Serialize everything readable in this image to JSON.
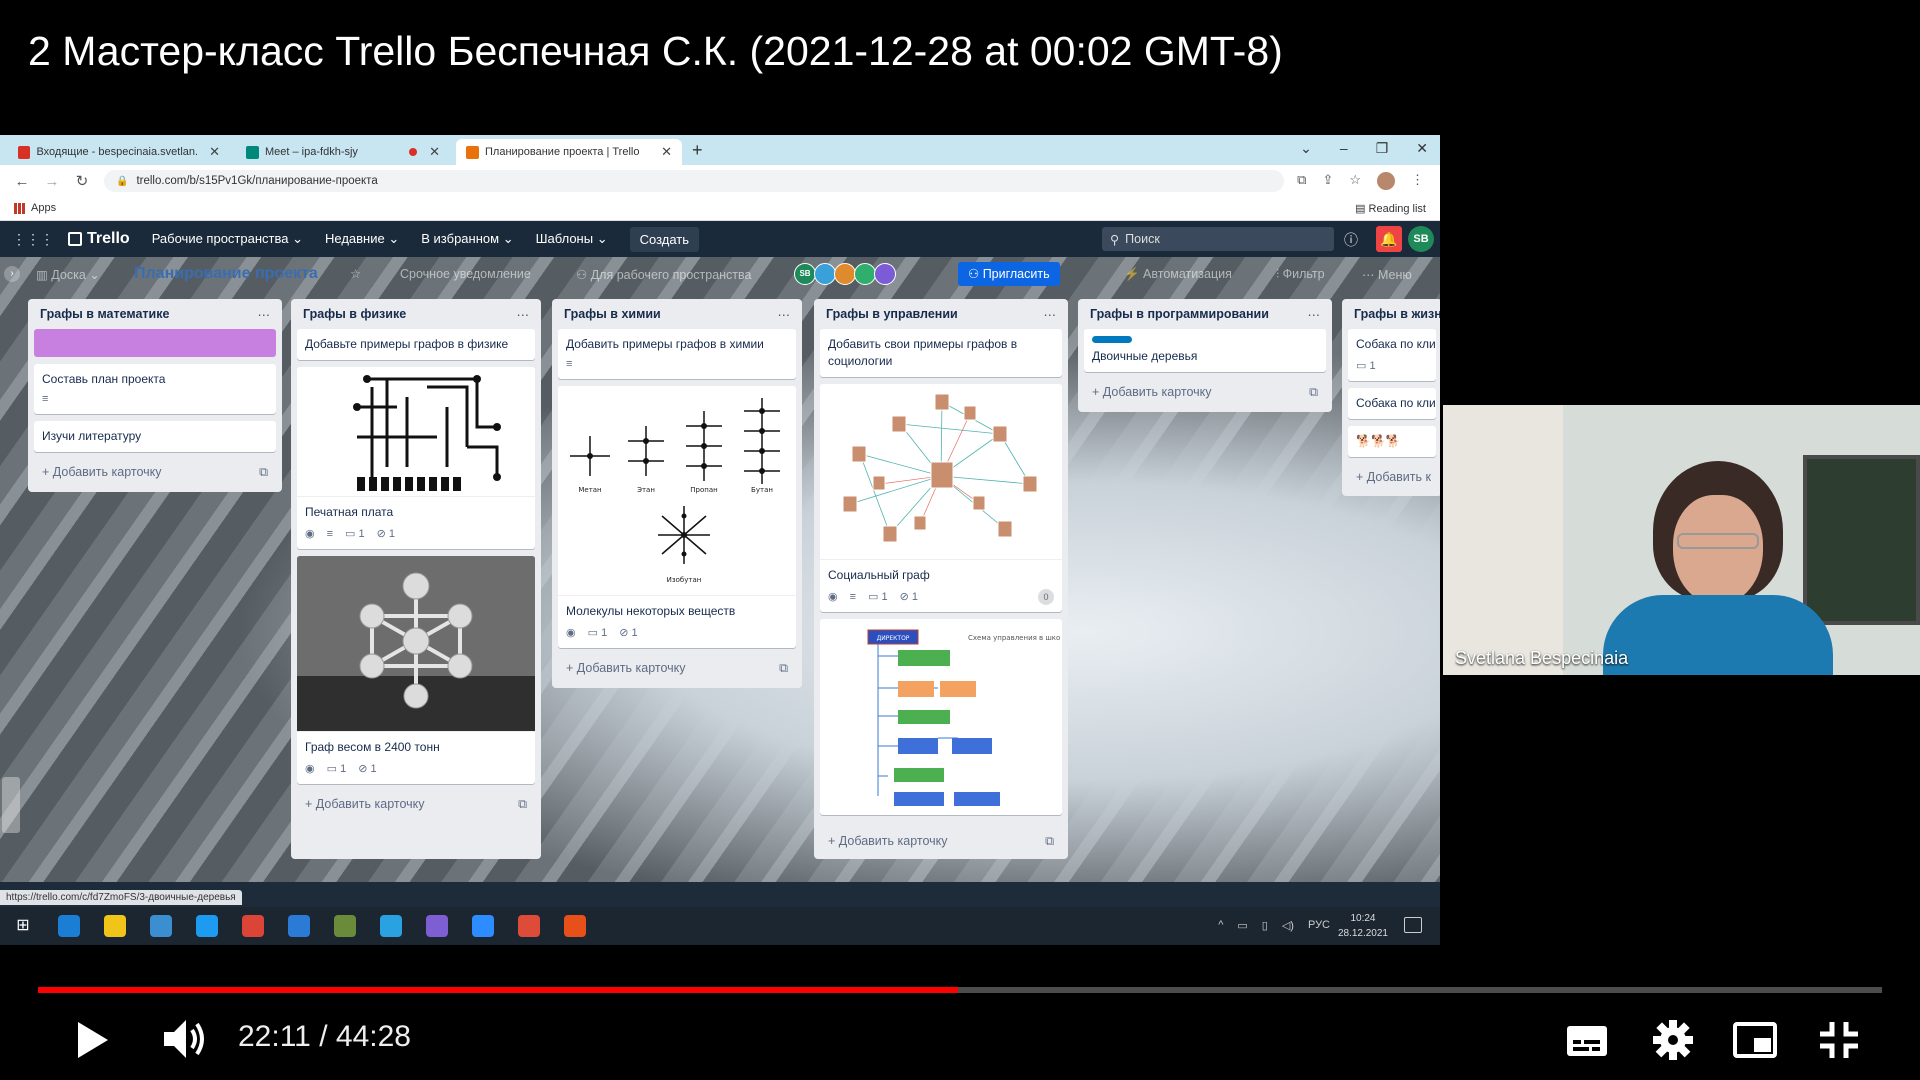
{
  "video": {
    "title": "2 Мастер-класс Trello Беспечная С.К. (2021-12-28 at 00:02 GMT-8)",
    "current_time": "22:11",
    "separator": "/",
    "duration": "44:28",
    "progress": 0.499
  },
  "browser": {
    "tabs": [
      {
        "label": "Входящие - bespecinaia.svetlan...",
        "icon_color": "#d93025"
      },
      {
        "label": "Meet – ipa-fdkh-sjy",
        "icon_color": "#00897b"
      },
      {
        "label": "Планирование проекта | Trello",
        "icon_color": "#e8710a"
      }
    ],
    "url": "trello.com/b/s15Pv1Gk/планирование-проекта",
    "bookmark_apps": "Apps",
    "reading_list": "Reading list",
    "status_url": "https://trello.com/c/fd7ZmoFS/3-двоичные-деревья"
  },
  "trello": {
    "logo": "Trello",
    "menu": [
      "Рабочие пространства",
      "Недавние",
      "В избранном",
      "Шаблоны"
    ],
    "create": "Создать",
    "search_placeholder": "Поиск",
    "avatar": "SB",
    "board": {
      "view": "Доска",
      "title": "Планирование проекта",
      "urgent": "Срочное уведомление",
      "workspace": "Для рабочего пространства",
      "members": [
        {
          "initials": "SB",
          "color": "#1e8a5a"
        },
        {
          "initials": "",
          "color": "#3aa0d8"
        },
        {
          "initials": "",
          "color": "#e08a2e"
        },
        {
          "initials": "",
          "color": "#2fae6e"
        },
        {
          "initials": "",
          "color": "#7b5cd6"
        }
      ],
      "invite": "Пригласить",
      "automation": "Автоматизация",
      "filter": "Фильтр",
      "menu": "Меню"
    },
    "add_card": "Добавить карточку",
    "add_card_short": "Добавить к",
    "lists": [
      {
        "title": "Графы в математике",
        "cards": [
          {
            "text": "Составь план проекта"
          },
          {
            "text": "Изучи литературу"
          }
        ]
      },
      {
        "title": "Графы в физике",
        "cards": [
          {
            "text": "Добавьте примеры графов в физике"
          },
          {
            "text": "Печатная плата",
            "comments": "1",
            "attachments": "1"
          },
          {
            "text": "Граф весом в 2400 тонн",
            "comments": "1",
            "attachments": "1"
          }
        ]
      },
      {
        "title": "Графы в химии",
        "cards": [
          {
            "text": "Добавить примеры графов в химии"
          },
          {
            "text": "Молекулы некоторых веществ",
            "comments": "1",
            "attachments": "1"
          }
        ],
        "molecules": [
          "Метан",
          "Этан",
          "Пропан",
          "Бутан",
          "Изобутан"
        ]
      },
      {
        "title": "Графы в управлении",
        "cards": [
          {
            "text": "Добавить свои примеры графов в социологии"
          },
          {
            "text": "Социальный граф",
            "comments": "1",
            "attachments": "1",
            "counter": "0"
          }
        ],
        "chart_header": "ДИРЕКТОР",
        "chart_subtitle": "Схема управления в школе"
      },
      {
        "title": "Графы в программировании",
        "cards": [
          {
            "text": "Двоичные деревья"
          }
        ]
      },
      {
        "title": "Графы в жизн",
        "cards": [
          {
            "text": "Собака по кли",
            "comments": "1"
          },
          {
            "text": "Собака по кли"
          }
        ]
      }
    ]
  },
  "taskbar": {
    "lang": "РУС",
    "time": "10:24",
    "date": "28.12.2021",
    "icon_colors": [
      "#1a7fd4",
      "#f0c419",
      "#3b8ed0",
      "#1d9bf0",
      "#db4437",
      "#2b7bd6",
      "#6a8b3a",
      "#2aa1e0",
      "#7d5fd3",
      "#2d8cff",
      "#dd4b39",
      "#e8501a"
    ]
  },
  "webcam": {
    "name": "Svetlana Bespecinaia"
  }
}
